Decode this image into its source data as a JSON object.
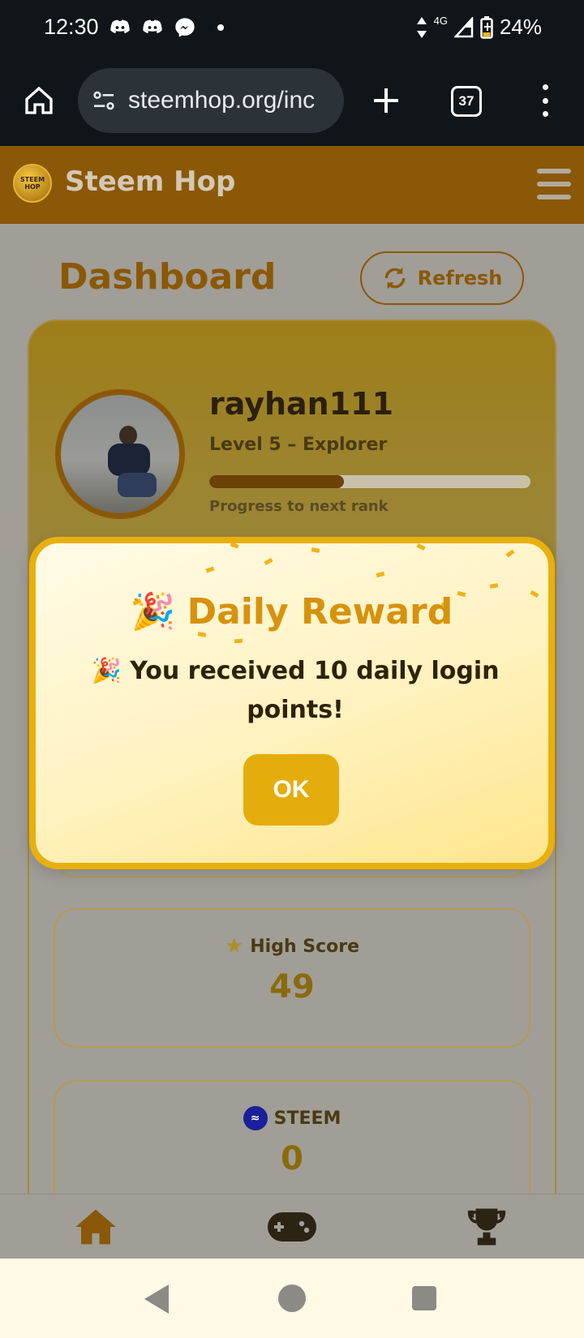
{
  "status_bar": {
    "time": "12:30",
    "network": "4G",
    "battery": "24%"
  },
  "browser": {
    "url": "steemhop.org/inc",
    "tab_count": "37"
  },
  "app": {
    "title": "Steem Hop",
    "logo_text": "STEEM HOP"
  },
  "dashboard": {
    "title": "Dashboard",
    "refresh_label": "Refresh",
    "username": "rayhan111",
    "level": "Level 5 – Explorer",
    "progress_caption": "Progress to next rank",
    "progress_fraction": 0.42
  },
  "stats": {
    "high_score_label": "High Score",
    "high_score_value": "49",
    "steem_label": "STEEM",
    "steem_value": "0"
  },
  "modal": {
    "title": "Daily Reward",
    "message_icon": "🎉",
    "message": "You received 10 daily login points!",
    "ok_label": "OK"
  },
  "colors": {
    "brand": "#8a5807",
    "accent": "#e8b00d",
    "ok_button": "#e5ad0c",
    "title": "#d7920c"
  },
  "icons": {
    "status": [
      "discord-icon",
      "discord-icon",
      "messenger-icon"
    ],
    "browser": [
      "home-icon",
      "tune-icon",
      "plus-icon",
      "tabs-icon",
      "more-vert-icon"
    ],
    "nav": [
      "home-icon",
      "gamepad-icon",
      "trophy-icon"
    ]
  }
}
